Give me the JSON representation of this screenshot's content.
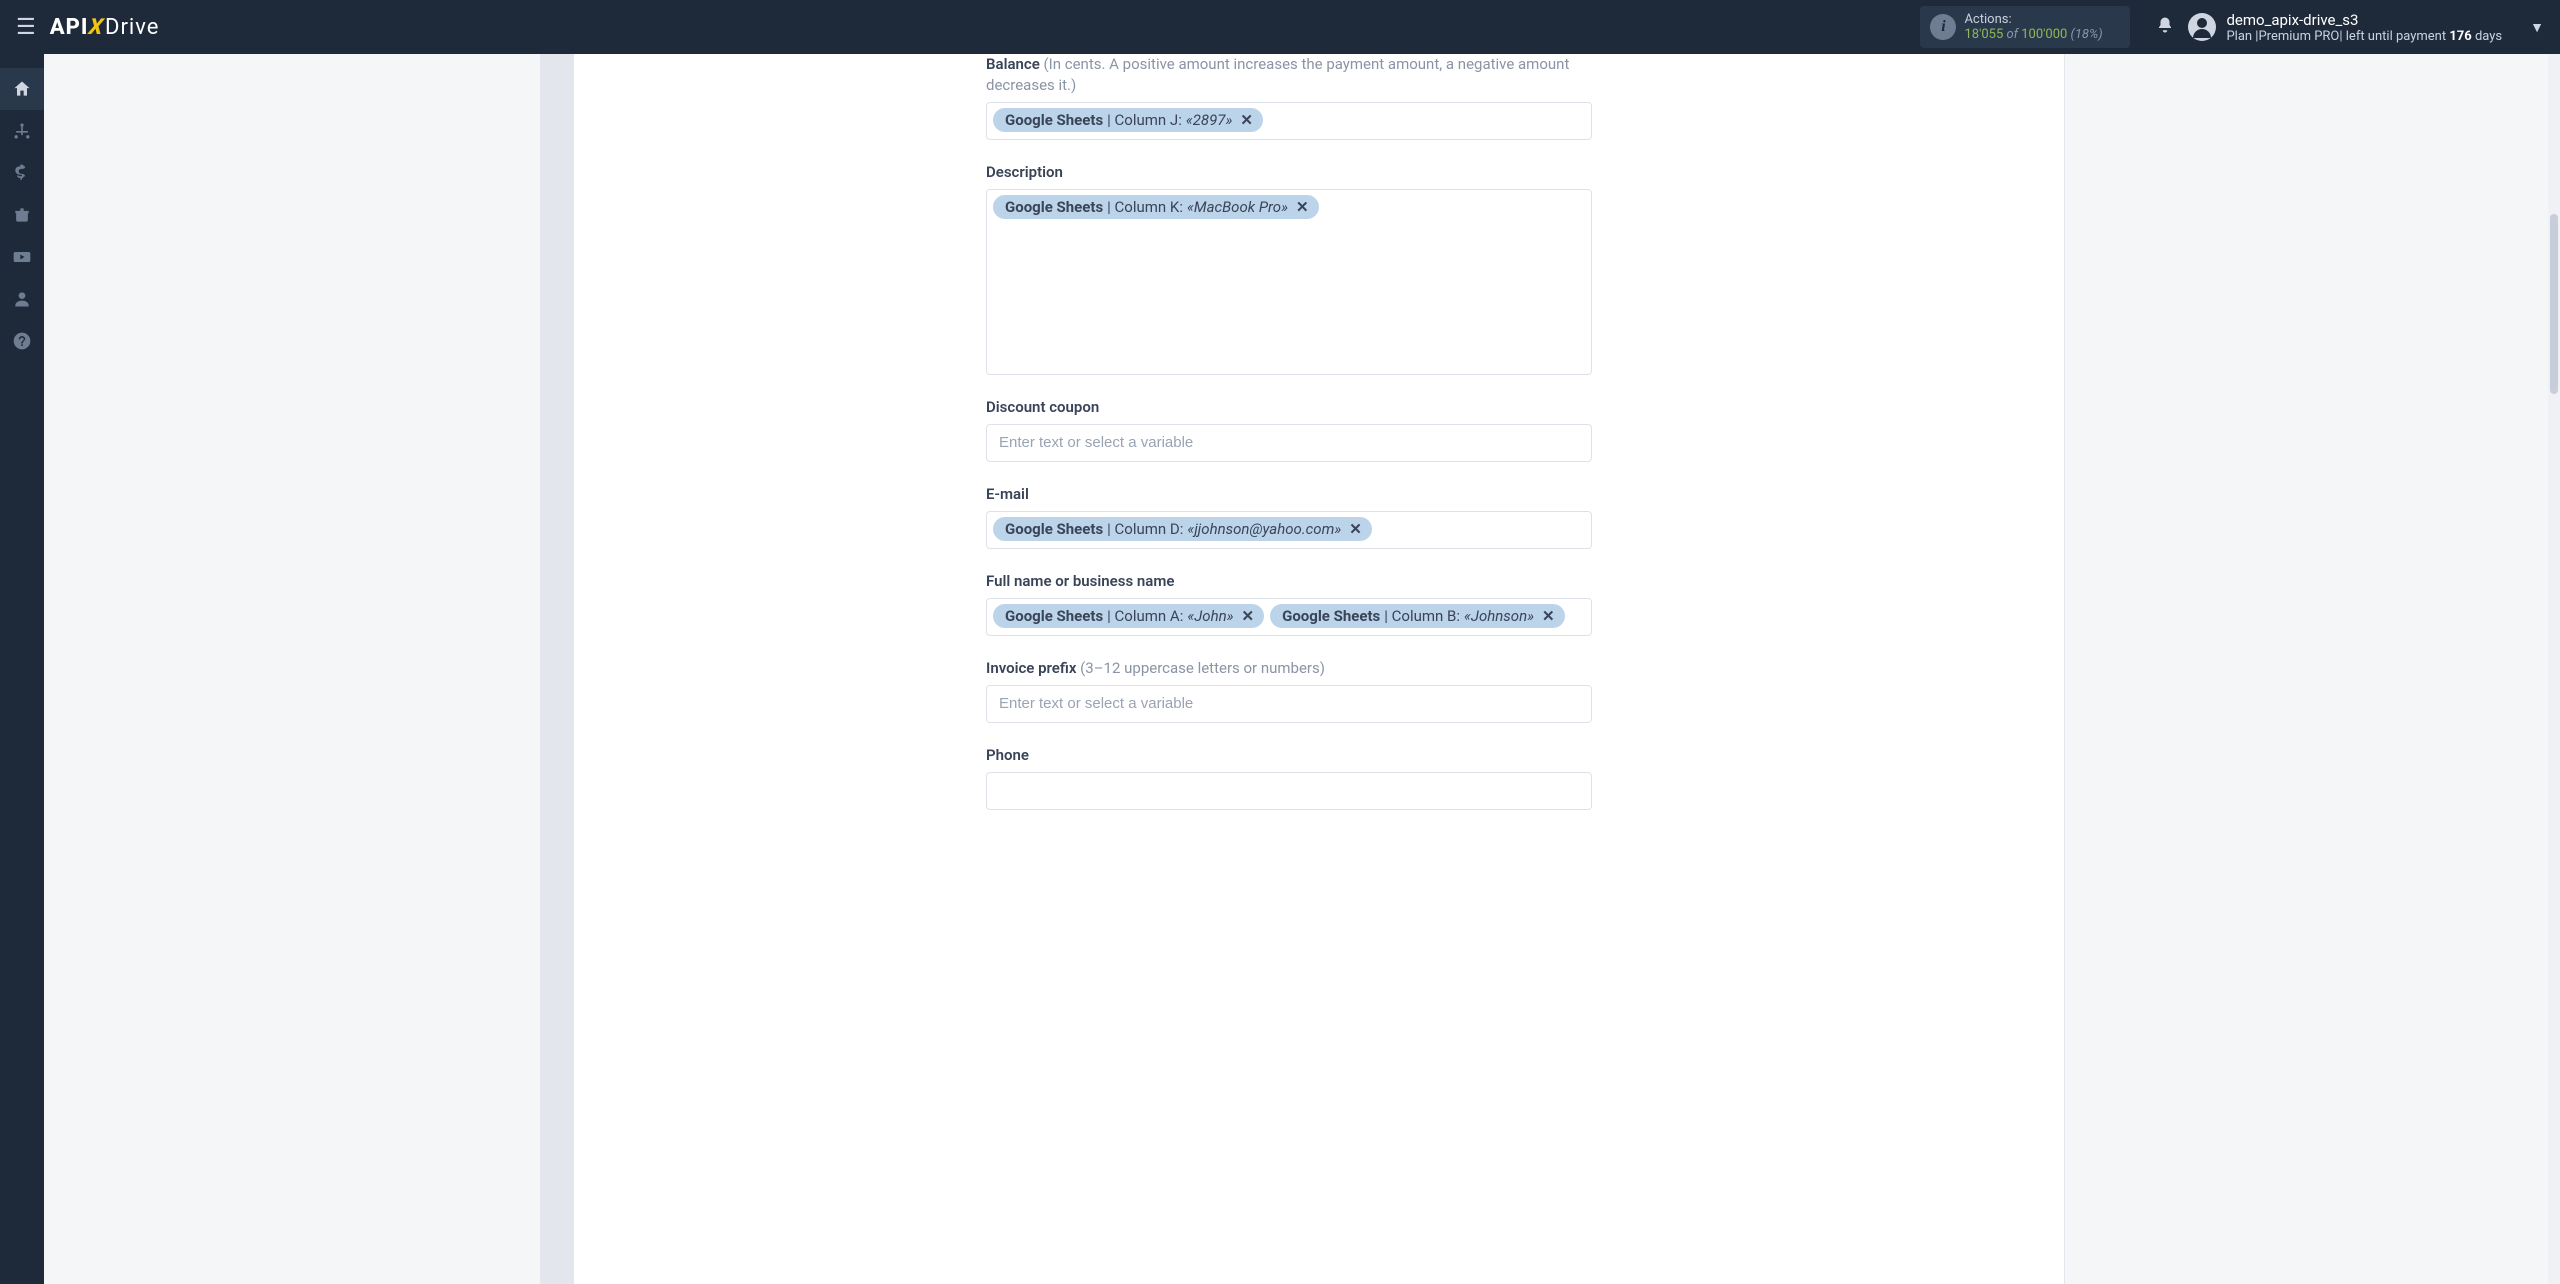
{
  "header": {
    "logo_api": "API",
    "logo_x": "X",
    "logo_drive": "Drive",
    "actions_label": "Actions:",
    "actions_used": "18'055",
    "actions_of": " of ",
    "actions_total": "100'000",
    "actions_pct": " (18%)",
    "username": "demo_apix-drive_s3",
    "plan_prefix": "Plan |",
    "plan_name": "Premium PRO",
    "plan_suffix": "| left until payment ",
    "days_num": "176",
    "days_word": " days"
  },
  "fields": [
    {
      "label": "Balance",
      "hint": " (In cents. A positive amount increases the payment amount, a negative amount decreases it.)",
      "placeholder": "",
      "tall": false,
      "chips": [
        {
          "source": "Google Sheets",
          "sep": " | ",
          "column": "Column J: ",
          "value": "«2897»"
        }
      ]
    },
    {
      "label": "Description",
      "hint": "",
      "placeholder": "",
      "tall": true,
      "chips": [
        {
          "source": "Google Sheets",
          "sep": " | ",
          "column": "Column K: ",
          "value": "«MacBook Pro»"
        }
      ]
    },
    {
      "label": "Discount coupon",
      "hint": "",
      "placeholder": "Enter text or select a variable",
      "tall": false,
      "chips": []
    },
    {
      "label": "E-mail",
      "hint": "",
      "placeholder": "",
      "tall": false,
      "chips": [
        {
          "source": "Google Sheets",
          "sep": " | ",
          "column": "Column D: ",
          "value": "«jjohnson@yahoo.com»"
        }
      ]
    },
    {
      "label": "Full name or business name",
      "hint": "",
      "placeholder": "",
      "tall": false,
      "chips": [
        {
          "source": "Google Sheets",
          "sep": " | ",
          "column": "Column A: ",
          "value": "«John»"
        },
        {
          "source": "Google Sheets",
          "sep": " | ",
          "column": "Column B: ",
          "value": "«Johnson»"
        }
      ]
    },
    {
      "label": "Invoice prefix",
      "hint": " (3–12 uppercase letters or numbers)",
      "placeholder": "Enter text or select a variable",
      "tall": false,
      "chips": []
    },
    {
      "label": "Phone",
      "hint": "",
      "placeholder": "",
      "tall": false,
      "chips": []
    }
  ]
}
